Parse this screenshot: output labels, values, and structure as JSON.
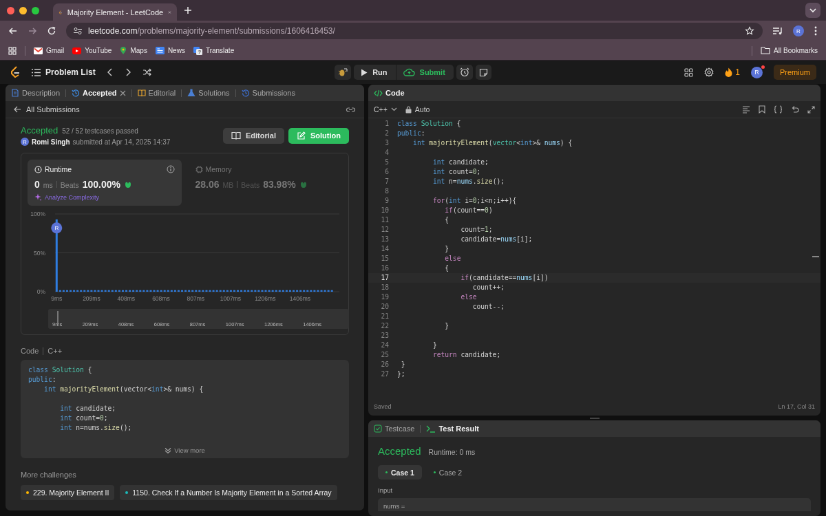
{
  "browser": {
    "tab_title": "Majority Element - LeetCode",
    "url_host": "leetcode.com",
    "url_path": "/problems/majority-element/submissions/1606416453/",
    "profile": "R",
    "bookmarks": [
      {
        "label": "Gmail",
        "kind": "gmail"
      },
      {
        "label": "YouTube",
        "kind": "youtube"
      },
      {
        "label": "Maps",
        "kind": "maps"
      },
      {
        "label": "News",
        "kind": "news"
      },
      {
        "label": "Translate",
        "kind": "translate"
      }
    ],
    "all_bookmarks": "All Bookmarks"
  },
  "navbar": {
    "problem_list": "Problem List",
    "run": "Run",
    "submit": "Submit",
    "streak": "1",
    "avatar": "R",
    "premium": "Premium"
  },
  "left_tabs": [
    {
      "label": "Description",
      "kind": "description",
      "selected": false,
      "closable": false
    },
    {
      "label": "Accepted",
      "kind": "accepted",
      "selected": true,
      "closable": true
    },
    {
      "label": "Editorial",
      "kind": "editorial",
      "selected": false,
      "closable": false
    },
    {
      "label": "Solutions",
      "kind": "solutions",
      "selected": false,
      "closable": false
    },
    {
      "label": "Submissions",
      "kind": "submissions",
      "selected": false,
      "closable": false
    }
  ],
  "submission": {
    "back": "All Submissions",
    "status": "Accepted",
    "testcases": "52 / 52 testcases passed",
    "avatar": "R",
    "author": "Romi Singh",
    "submitted": "submitted at Apr 14, 2025 14:37",
    "buttons": [
      {
        "label": "Editorial",
        "kind": "editorial"
      },
      {
        "label": "Solution",
        "kind": "solution"
      }
    ]
  },
  "stats": [
    {
      "label": "Runtime",
      "kind": "runtime",
      "selected": true,
      "value": "0",
      "unit": "ms",
      "beats_label": "Beats",
      "beats": "100.00%",
      "link": "Analyze Complexity"
    },
    {
      "label": "Memory",
      "kind": "memory",
      "selected": false,
      "value": "28.06",
      "unit": "MB",
      "beats_label": "Beats",
      "beats": "83.98%"
    }
  ],
  "chart_data": {
    "type": "bar",
    "ylim": [
      0,
      100
    ],
    "xlim": [
      0,
      1600
    ],
    "yticks": [
      {
        "value": 0,
        "label": "0%"
      },
      {
        "value": 50,
        "label": "50%"
      },
      {
        "value": 100,
        "label": "100%"
      }
    ],
    "xticks": [
      {
        "value": 9,
        "label": "9ms"
      },
      {
        "value": 209,
        "label": "209ms"
      },
      {
        "value": 408,
        "label": "408ms"
      },
      {
        "value": 608,
        "label": "608ms"
      },
      {
        "value": 807,
        "label": "807ms"
      },
      {
        "value": 1007,
        "label": "1007ms"
      },
      {
        "value": 1206,
        "label": "1206ms"
      },
      {
        "value": 1406,
        "label": "1406ms"
      }
    ],
    "x": [
      9,
      29,
      49,
      69,
      89,
      109,
      129,
      149,
      169,
      189,
      209,
      229,
      249,
      269,
      289,
      309,
      329,
      349,
      369,
      389,
      409,
      429,
      449,
      469,
      489,
      509,
      529,
      549,
      569,
      589,
      609,
      629,
      649,
      669,
      689,
      709,
      729,
      749,
      769,
      789,
      809,
      829,
      849,
      869,
      889,
      909,
      929,
      949,
      969,
      989,
      1009,
      1029,
      1049,
      1069,
      1089,
      1109,
      1129,
      1149,
      1169,
      1189,
      1209,
      1229,
      1249,
      1269,
      1289,
      1309,
      1329,
      1349,
      1369,
      1389,
      1409,
      1429,
      1449,
      1469,
      1489,
      1509,
      1529,
      1549,
      1569,
      1589
    ],
    "values": [
      93,
      2,
      2,
      2,
      2,
      2,
      2,
      2,
      2,
      2,
      2,
      2,
      2,
      2,
      2,
      2,
      2,
      2,
      2,
      2,
      2,
      2,
      2,
      2,
      2,
      2,
      2,
      2,
      2,
      2,
      2,
      2,
      2,
      2,
      2,
      2,
      2,
      2,
      2,
      2,
      2,
      2,
      2,
      2,
      2,
      2,
      2,
      2,
      2,
      2,
      2,
      2,
      2,
      2,
      2,
      2,
      2,
      2,
      2,
      2,
      2,
      2,
      2,
      2,
      2,
      2,
      2,
      2,
      2,
      2,
      2,
      2,
      2,
      2,
      2,
      2,
      2,
      2,
      2,
      2
    ],
    "annotations": [
      {
        "x": 9,
        "y": 82,
        "text": "R"
      }
    ]
  },
  "overview": {
    "level": 0.02,
    "labels": [
      "9ms",
      "209ms",
      "408ms",
      "608ms",
      "807ms",
      "1007ms",
      "1206ms",
      "1406ms"
    ]
  },
  "code_preview": {
    "label": "Code",
    "language": "C++",
    "view_more": "View more",
    "lines": [
      {
        "kind": "code",
        "tokens": [
          {
            "kind": "type",
            "text": "class "
          },
          {
            "kind": "cls",
            "text": "Solution"
          },
          {
            "kind": "plain",
            "text": " {"
          }
        ]
      },
      {
        "kind": "code",
        "tokens": [
          {
            "kind": "type",
            "text": "public"
          },
          {
            "kind": "plain",
            "text": ":"
          }
        ]
      },
      {
        "kind": "code",
        "tokens": [
          {
            "kind": "type",
            "text": "    int"
          },
          {
            "kind": "fn",
            "text": " majorityElement"
          },
          {
            "kind": "plain",
            "text": "(vector<"
          },
          {
            "kind": "type",
            "text": "int"
          },
          {
            "kind": "plain",
            "text": ">& nums) {"
          }
        ]
      },
      {
        "kind": "blank"
      },
      {
        "kind": "code",
        "tokens": [
          {
            "kind": "type",
            "text": "        int"
          },
          {
            "kind": "plain",
            "text": " candidate;"
          }
        ]
      },
      {
        "kind": "code",
        "tokens": [
          {
            "kind": "type",
            "text": "        int"
          },
          {
            "kind": "plain",
            "text": " count="
          },
          {
            "kind": "num",
            "text": "0"
          },
          {
            "kind": "plain",
            "text": ";"
          }
        ]
      },
      {
        "kind": "code",
        "tokens": [
          {
            "kind": "type",
            "text": "        int"
          },
          {
            "kind": "plain",
            "text": " n=nums."
          },
          {
            "kind": "fn",
            "text": "size"
          },
          {
            "kind": "plain",
            "text": "();"
          }
        ]
      }
    ]
  },
  "more_challenges": {
    "title": "More challenges",
    "items": [
      {
        "label": "229. Majority Element II",
        "color": "#ffb800"
      },
      {
        "label": "1150. Check If a Number Is Majority Element in a Sorted Array",
        "color": "#1cbaba"
      }
    ]
  },
  "editor": {
    "title": "Code",
    "language": "C++",
    "mode": "Auto",
    "status": "Saved",
    "cursor": "Ln 17, Col 31",
    "lines": [
      {
        "number": "1",
        "selected": false,
        "tokens": [
          {
            "kind": "type",
            "text": "class "
          },
          {
            "kind": "cls",
            "text": "Solution"
          },
          {
            "kind": "plain",
            "text": " {"
          }
        ]
      },
      {
        "number": "2",
        "selected": false,
        "tokens": [
          {
            "kind": "type",
            "text": "public"
          },
          {
            "kind": "plain",
            "text": ":"
          }
        ]
      },
      {
        "number": "3",
        "selected": false,
        "tokens": [
          {
            "kind": "type",
            "text": "    int"
          },
          {
            "kind": "fn",
            "text": " majorityElement"
          },
          {
            "kind": "plain",
            "text": "("
          },
          {
            "kind": "cls",
            "text": "vector"
          },
          {
            "kind": "plain",
            "text": "<"
          },
          {
            "kind": "type",
            "text": "int"
          },
          {
            "kind": "plain",
            "text": ">& "
          },
          {
            "kind": "var",
            "text": "nums"
          },
          {
            "kind": "plain",
            "text": ") {"
          }
        ]
      },
      {
        "number": "4",
        "selected": false
      },
      {
        "number": "5",
        "selected": false,
        "tokens": [
          {
            "kind": "type",
            "text": "         int"
          },
          {
            "kind": "plain",
            "text": " candidate;"
          }
        ]
      },
      {
        "number": "6",
        "selected": false,
        "tokens": [
          {
            "kind": "type",
            "text": "         int"
          },
          {
            "kind": "plain",
            "text": " count="
          },
          {
            "kind": "num",
            "text": "0"
          },
          {
            "kind": "plain",
            "text": ";"
          }
        ]
      },
      {
        "number": "7",
        "selected": false,
        "tokens": [
          {
            "kind": "type",
            "text": "         int"
          },
          {
            "kind": "plain",
            "text": " n="
          },
          {
            "kind": "var",
            "text": "nums"
          },
          {
            "kind": "plain",
            "text": "."
          },
          {
            "kind": "fn",
            "text": "size"
          },
          {
            "kind": "plain",
            "text": "();"
          }
        ]
      },
      {
        "number": "8",
        "selected": false
      },
      {
        "number": "9",
        "selected": false,
        "tokens": [
          {
            "kind": "kw",
            "text": "         for"
          },
          {
            "kind": "plain",
            "text": "("
          },
          {
            "kind": "type",
            "text": "int"
          },
          {
            "kind": "plain",
            "text": " i="
          },
          {
            "kind": "num",
            "text": "0"
          },
          {
            "kind": "plain",
            "text": ";i<n;i++){"
          }
        ]
      },
      {
        "number": "10",
        "selected": false,
        "tokens": [
          {
            "kind": "kw",
            "text": "            if"
          },
          {
            "kind": "plain",
            "text": "(count=="
          },
          {
            "kind": "num",
            "text": "0"
          },
          {
            "kind": "plain",
            "text": ")"
          }
        ]
      },
      {
        "number": "11",
        "selected": false,
        "tokens": [
          {
            "kind": "plain",
            "text": "            {"
          }
        ]
      },
      {
        "number": "12",
        "selected": false,
        "tokens": [
          {
            "kind": "plain",
            "text": "                count="
          },
          {
            "kind": "num",
            "text": "1"
          },
          {
            "kind": "plain",
            "text": ";"
          }
        ]
      },
      {
        "number": "13",
        "selected": false,
        "tokens": [
          {
            "kind": "plain",
            "text": "                candidate="
          },
          {
            "kind": "var",
            "text": "nums"
          },
          {
            "kind": "plain",
            "text": "[i];"
          }
        ]
      },
      {
        "number": "14",
        "selected": false,
        "tokens": [
          {
            "kind": "plain",
            "text": "            }"
          }
        ]
      },
      {
        "number": "15",
        "selected": false,
        "tokens": [
          {
            "kind": "kw",
            "text": "            else"
          }
        ]
      },
      {
        "number": "16",
        "selected": false,
        "tokens": [
          {
            "kind": "plain",
            "text": "            {"
          }
        ]
      },
      {
        "number": "17",
        "selected": true,
        "tokens": [
          {
            "kind": "kw",
            "text": "                if"
          },
          {
            "kind": "plain",
            "text": "(candidate=="
          },
          {
            "kind": "var",
            "text": "nums"
          },
          {
            "kind": "plain",
            "text": "[i])"
          }
        ]
      },
      {
        "number": "18",
        "selected": false,
        "tokens": [
          {
            "kind": "plain",
            "text": "                   count++;"
          }
        ]
      },
      {
        "number": "19",
        "selected": false,
        "tokens": [
          {
            "kind": "kw",
            "text": "                else"
          }
        ]
      },
      {
        "number": "20",
        "selected": false,
        "tokens": [
          {
            "kind": "plain",
            "text": "                   count--;"
          }
        ]
      },
      {
        "number": "21",
        "selected": false
      },
      {
        "number": "22",
        "selected": false,
        "tokens": [
          {
            "kind": "plain",
            "text": "            }"
          }
        ]
      },
      {
        "number": "23",
        "selected": false
      },
      {
        "number": "24",
        "selected": false,
        "tokens": [
          {
            "kind": "plain",
            "text": "         }"
          }
        ]
      },
      {
        "number": "25",
        "selected": false,
        "tokens": [
          {
            "kind": "kw",
            "text": "         return"
          },
          {
            "kind": "plain",
            "text": " candidate;"
          }
        ]
      },
      {
        "number": "26",
        "selected": false,
        "tokens": [
          {
            "kind": "plain",
            "text": " }"
          }
        ]
      },
      {
        "number": "27",
        "selected": false,
        "tokens": [
          {
            "kind": "plain",
            "text": "};"
          }
        ]
      }
    ]
  },
  "test_panel": {
    "tabs": [
      {
        "label": "Testcase",
        "kind": "testcase",
        "selected": false
      },
      {
        "label": "Test Result",
        "kind": "result",
        "selected": true
      }
    ],
    "status": "Accepted",
    "runtime": "Runtime: 0 ms",
    "cases": [
      {
        "label": "Case 1",
        "selected": true
      },
      {
        "label": "Case 2",
        "selected": false
      }
    ],
    "input_label": "Input",
    "input_value": "nums ="
  }
}
